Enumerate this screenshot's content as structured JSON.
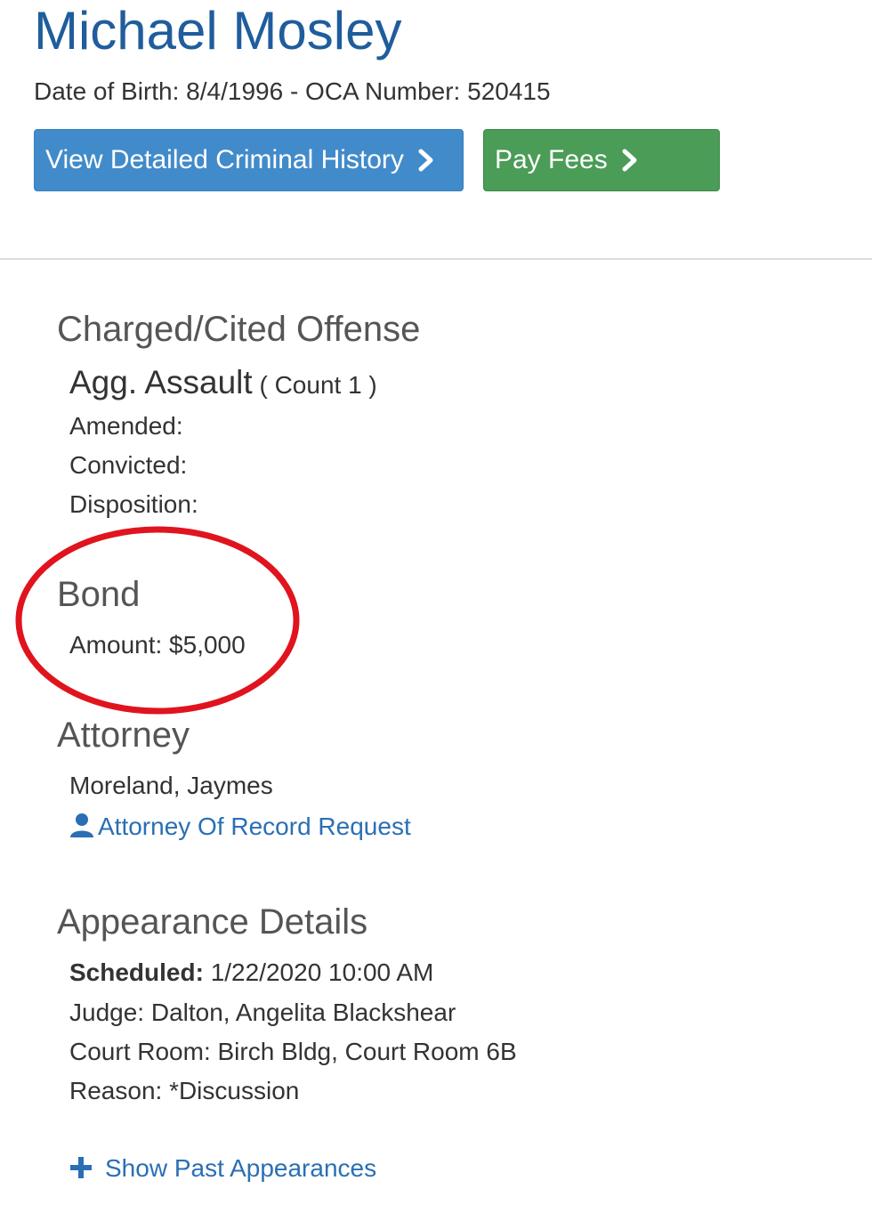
{
  "person": {
    "name": "Michael Mosley",
    "subline": "Date of Birth: 8/4/1996 - OCA Number: 520415"
  },
  "buttons": {
    "criminal_history": "View Detailed Criminal History",
    "pay_fees": "Pay Fees"
  },
  "offense": {
    "section_title": "Charged/Cited Offense",
    "name": "Agg. Assault",
    "count": "( Count 1 )",
    "amended_label": "Amended:",
    "convicted_label": "Convicted:",
    "disposition_label": "Disposition:"
  },
  "bond": {
    "section_title": "Bond",
    "amount": "Amount: $5,000",
    "highlight_color": "#e0141e"
  },
  "attorney": {
    "section_title": "Attorney",
    "name": "Moreland, Jaymes",
    "request_link": "Attorney Of Record Request"
  },
  "appearance": {
    "section_title": "Appearance Details",
    "scheduled_label": "Scheduled:",
    "scheduled_value": "1/22/2020 10:00 AM",
    "judge": "Judge: Dalton, Angelita Blackshear",
    "court_room": "Court Room: Birch Bldg, Court Room 6B",
    "reason": "Reason: *Discussion",
    "show_past": "Show Past Appearances"
  },
  "colors": {
    "title_blue": "#1f5d9c",
    "button_blue": "#428bca",
    "button_green": "#4a9c57",
    "link_blue": "#2a6fb4"
  }
}
